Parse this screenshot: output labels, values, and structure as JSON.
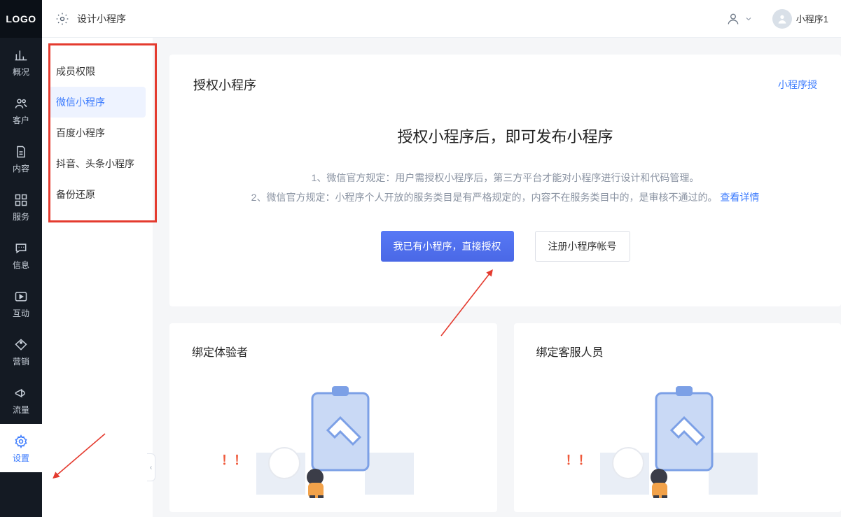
{
  "logo": "LOGO",
  "topbar": {
    "design_label": "设计小程序",
    "username": "小程序1"
  },
  "sidebar": [
    {
      "key": "overview",
      "label": "概况"
    },
    {
      "key": "customers",
      "label": "客户"
    },
    {
      "key": "content",
      "label": "内容"
    },
    {
      "key": "services",
      "label": "服务"
    },
    {
      "key": "messages",
      "label": "信息"
    },
    {
      "key": "interact",
      "label": "互动"
    },
    {
      "key": "marketing",
      "label": "营销"
    },
    {
      "key": "traffic",
      "label": "流量"
    },
    {
      "key": "settings",
      "label": "设置"
    }
  ],
  "subside": [
    {
      "key": "member-permission",
      "label": "成员权限"
    },
    {
      "key": "wechat-mini",
      "label": "微信小程序"
    },
    {
      "key": "baidu-mini",
      "label": "百度小程序"
    },
    {
      "key": "douyin-mini",
      "label": "抖音、头条小程序"
    },
    {
      "key": "backup-restore",
      "label": "备份还原"
    }
  ],
  "auth_card": {
    "title": "授权小程序",
    "top_link": "小程序授",
    "heading": "授权小程序后，即可发布小程序",
    "desc_line1": "1、微信官方规定：用户需授权小程序后，第三方平台才能对小程序进行设计和代码管理。",
    "desc_line2_prefix": "2、微信官方规定：小程序个人开放的服务类目是有严格规定的，内容不在服务类目中的，是审核不通过的。",
    "desc_line2_link": "查看详情",
    "btn_primary": "我已有小程序，直接授权",
    "btn_outline": "注册小程序帐号"
  },
  "bind_experience": {
    "title": "绑定体验者",
    "exclaim": "！！"
  },
  "bind_service": {
    "title": "绑定客服人员",
    "exclaim": "！！"
  }
}
